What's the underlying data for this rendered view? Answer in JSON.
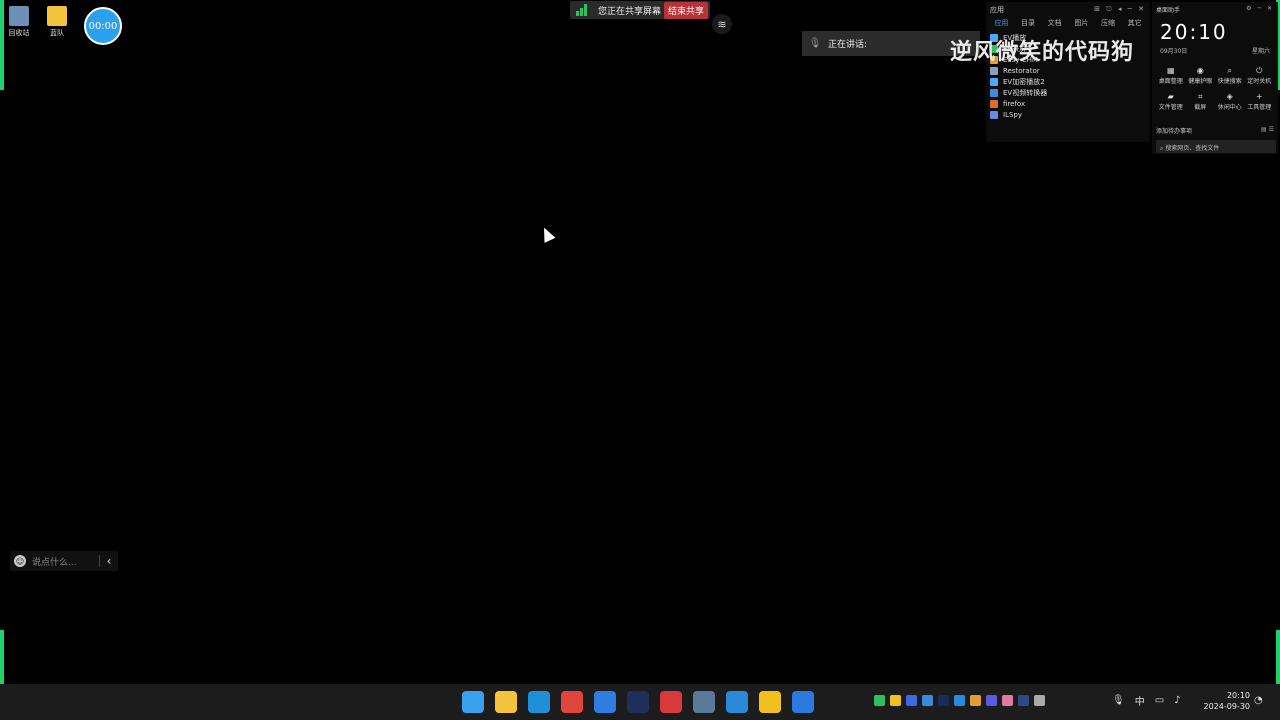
{
  "desktop": {
    "icons": [
      {
        "label": "回收站",
        "icon": "recycle-bin-icon",
        "color": "#6b8fb5"
      },
      {
        "label": "蓝队",
        "icon": "folder-icon",
        "color": "#f3c33c"
      }
    ],
    "timer": "00:00"
  },
  "sharebar": {
    "status": "您正在共享屏幕",
    "end_label": "结束共享"
  },
  "speaking": {
    "label": "正在讲话:"
  },
  "watermark": {
    "text": "逆风微笑的代码狗",
    "logo": "bilibili"
  },
  "app_panel": {
    "title": "应用",
    "controls": "⊞ ⎋ ◂ ─ ✕",
    "tabs": [
      "应用",
      "目录",
      "文档",
      "图片",
      "压缩",
      "其它"
    ],
    "active_tab": 0,
    "apps": [
      "EV播放",
      "EV录屏",
      "Easy CHM",
      "Restorator",
      "EV加密播放2",
      "EV视频转换器",
      "firefox",
      "ILSpy"
    ],
    "app_colors": [
      "#4aa8ff",
      "#2ec05f",
      "#e0a030",
      "#8aa0c0",
      "#4aa8ff",
      "#3a8ee0",
      "#e06a2a",
      "#6a8ae0"
    ]
  },
  "assistant": {
    "title": "桌面助手",
    "controls": "⚙ ─ ✕",
    "clock": "20:10",
    "date": "09月30日",
    "weekday": "星期六",
    "tools_row1": [
      {
        "label": "桌面整理",
        "icon": "grid-icon"
      },
      {
        "label": "健康护眼",
        "icon": "eye-icon"
      },
      {
        "label": "快捷搜索",
        "icon": "search-icon"
      },
      {
        "label": "定时关机",
        "icon": "power-icon"
      }
    ],
    "tools_row2": [
      {
        "label": "文件管理",
        "icon": "folder-icon"
      },
      {
        "label": "截屏",
        "icon": "crop-icon"
      },
      {
        "label": "休闲中心",
        "icon": "gamepad-icon"
      },
      {
        "label": "工具管理",
        "icon": "plus-icon"
      }
    ],
    "todo": "添加待办事项",
    "search_placeholder": "搜索网页、查找文件"
  },
  "chat": {
    "placeholder": "说点什么..."
  },
  "taskbar": {
    "apps": [
      {
        "name": "start-icon",
        "color": "#3aa0f0"
      },
      {
        "name": "file-explorer-icon",
        "color": "#f3c33c"
      },
      {
        "name": "edge-icon",
        "color": "#1f8fd8"
      },
      {
        "name": "chrome-icon",
        "color": "#e0443a"
      },
      {
        "name": "pinned-app-icon",
        "color": "#2f7de0"
      },
      {
        "name": "visual-studio-icon",
        "color": "#1f2f5a"
      },
      {
        "name": "redis-icon",
        "color": "#d8393a"
      },
      {
        "name": "python-icon",
        "color": "#5a7a9a"
      },
      {
        "name": "vmware-icon",
        "color": "#2a8ad8"
      },
      {
        "name": "notes-icon",
        "color": "#f0c020"
      },
      {
        "name": "meeting-icon",
        "color": "#2a7ae0"
      }
    ],
    "tray": [
      "#2ec05f",
      "#f0c020",
      "#3a6ae0",
      "#3a8ae0",
      "#1a2a5a",
      "#2a8ae0",
      "#e0a030",
      "#5a5ae0",
      "#e07aa0",
      "#2a4a8a",
      "#aaaaaa"
    ],
    "ime": "中",
    "time": "20:10",
    "date": "2024-09-30"
  }
}
